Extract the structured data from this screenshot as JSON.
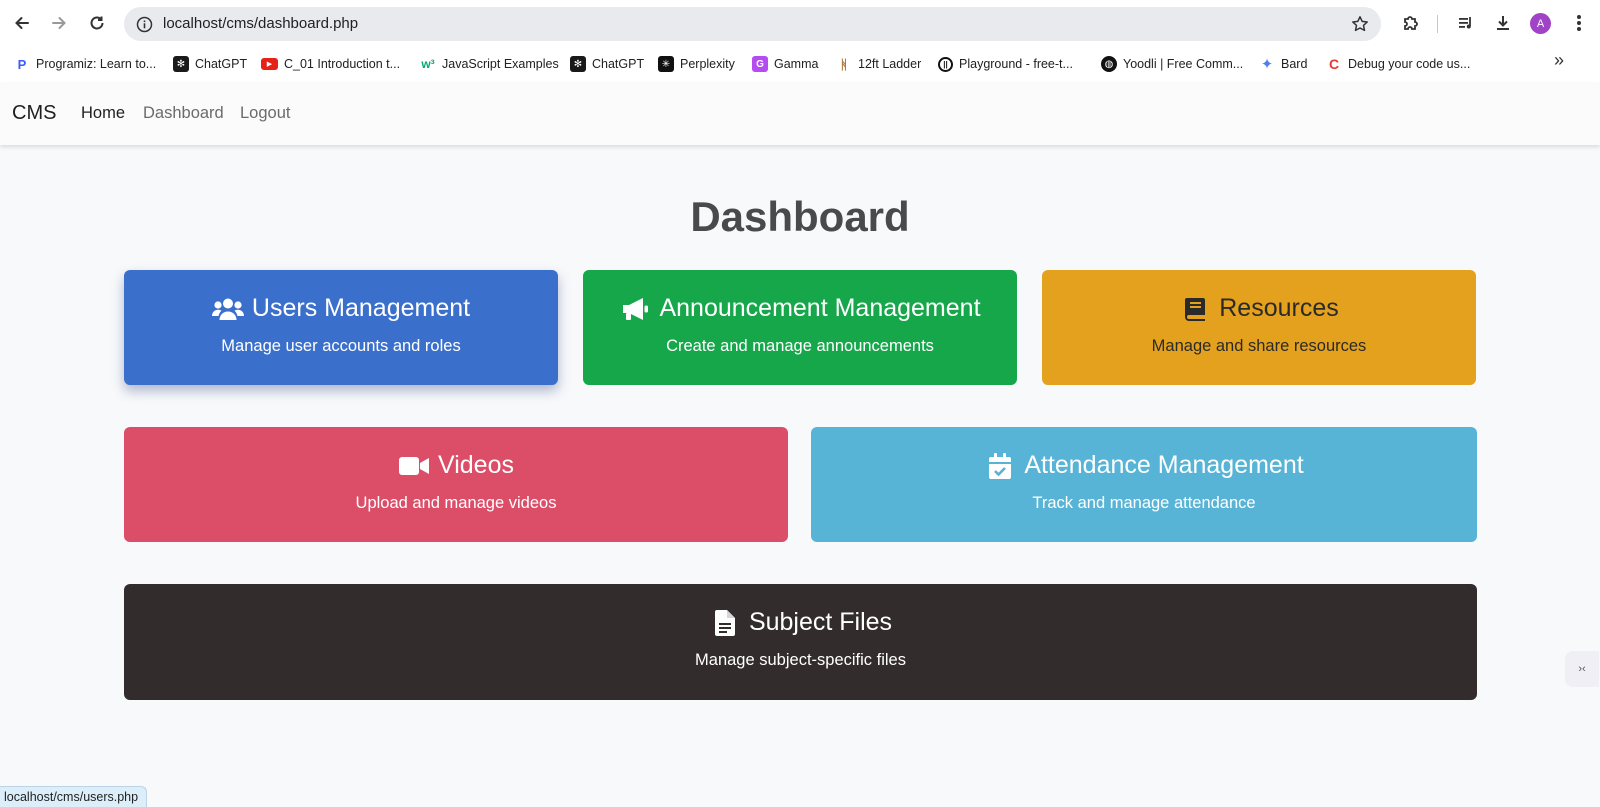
{
  "browser": {
    "url": "localhost/cms/dashboard.php",
    "avatar_letter": "A",
    "bookmarks": [
      {
        "label": "Programiz: Learn to...",
        "icon": "programiz-icon",
        "color": "#3d5afe"
      },
      {
        "label": "ChatGPT",
        "icon": "chatgpt-icon",
        "color": "#1a1a1a"
      },
      {
        "label": "C_01 Introduction t...",
        "icon": "youtube-icon",
        "color": "#e62117"
      },
      {
        "label": "JavaScript Examples",
        "icon": "w3-icon",
        "color": "#04aa6d"
      },
      {
        "label": "ChatGPT",
        "icon": "chatgpt-icon",
        "color": "#1a1a1a"
      },
      {
        "label": "Perplexity",
        "icon": "perplexity-icon",
        "color": "#111111"
      },
      {
        "label": "Gamma",
        "icon": "gamma-icon",
        "color": "#b44cf0"
      },
      {
        "label": "12ft Ladder",
        "icon": "ladder-icon",
        "color": "#b27a3c"
      },
      {
        "label": "Playground - free-t...",
        "icon": "playground-icon",
        "color": "#111111"
      },
      {
        "label": "Yoodli | Free Comm...",
        "icon": "globe-icon",
        "color": "#111111"
      },
      {
        "label": "Bard",
        "icon": "bard-icon",
        "color": "#4f7cf0"
      },
      {
        "label": "Debug your code us...",
        "icon": "codeium-icon",
        "color": "#e53935"
      }
    ],
    "status_url": "localhost/cms/users.php"
  },
  "navbar": {
    "brand": "CMS",
    "links": [
      {
        "label": "Home",
        "active": true
      },
      {
        "label": "Dashboard",
        "active": false
      },
      {
        "label": "Logout",
        "active": false
      }
    ]
  },
  "dashboard": {
    "title": "Dashboard",
    "cards": [
      {
        "title": "Users Management",
        "desc": "Manage user accounts and roles",
        "icon": "users-icon",
        "color": "#3a70cc"
      },
      {
        "title": "Announcement Management",
        "desc": "Create and manage announcements",
        "icon": "megaphone-icon",
        "color": "#17a74b"
      },
      {
        "title": "Resources",
        "desc": "Manage and share resources",
        "icon": "book-icon",
        "color": "#e4a11e"
      },
      {
        "title": "Videos",
        "desc": "Upload and manage videos",
        "icon": "video-icon",
        "color": "#dc4d68"
      },
      {
        "title": "Attendance Management",
        "desc": "Track and manage attendance",
        "icon": "calendar-check-icon",
        "color": "#57b4d6"
      },
      {
        "title": "Subject Files",
        "desc": "Manage subject-specific files",
        "icon": "file-icon",
        "color": "#332c2c"
      }
    ]
  }
}
